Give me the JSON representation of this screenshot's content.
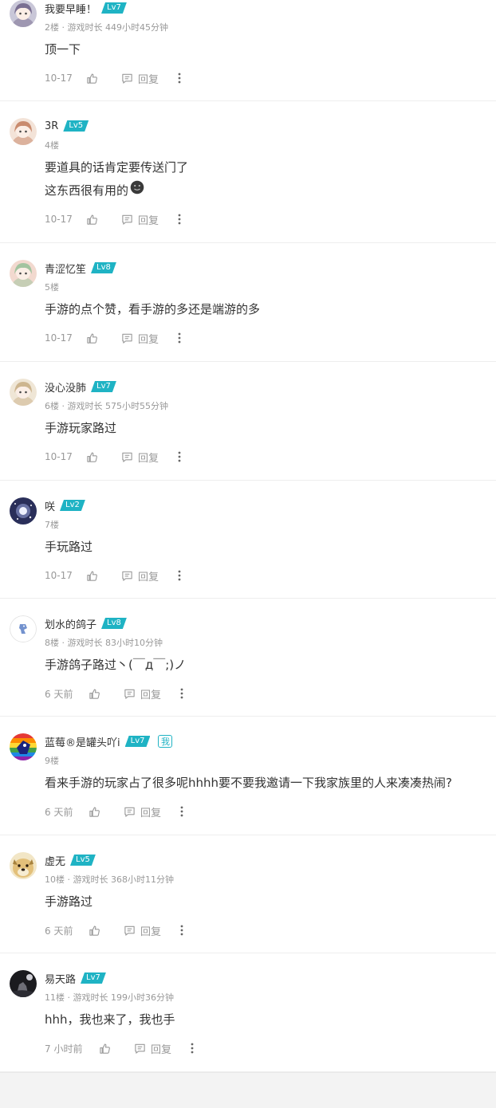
{
  "comments": [
    {
      "name": "我要早睡！",
      "level": "Lv7",
      "floor": "2楼",
      "playtime": "游戏时长 449小时45分钟",
      "lines": [
        "顶一下"
      ],
      "date": "10-17",
      "reply": "回复",
      "avatar": "avatar-anime-girl-pink",
      "colors": [
        "#c9c7d8",
        "#7a6f92"
      ]
    },
    {
      "name": "3R",
      "level": "Lv5",
      "floor": "4楼",
      "playtime": "",
      "lines": [
        "要道具的话肯定要传送门了",
        "这东西很有用的"
      ],
      "emoji": "grinning-face-emoji",
      "date": "10-17",
      "reply": "回复",
      "avatar": "avatar-anime-girl-white-hair",
      "colors": [
        "#f3e3d8",
        "#c98b6e"
      ]
    },
    {
      "name": "青涩忆笙",
      "level": "Lv8",
      "floor": "5楼",
      "playtime": "",
      "lines": [
        "手游的点个赞，看手游的多还是端游的多"
      ],
      "date": "10-17",
      "reply": "回复",
      "avatar": "avatar-anime-sleeping",
      "colors": [
        "#f2d9cf",
        "#a3c4a0"
      ]
    },
    {
      "name": "没心没肺",
      "level": "Lv7",
      "floor": "6楼",
      "playtime": "游戏时长 575小时55分钟",
      "lines": [
        "手游玩家路过"
      ],
      "date": "10-17",
      "reply": "回复",
      "avatar": "avatar-anime-girl-blonde",
      "colors": [
        "#efe6d6",
        "#cdb58f"
      ]
    },
    {
      "name": "咲",
      "level": "Lv2",
      "floor": "7楼",
      "playtime": "",
      "lines": [
        "手玩路过"
      ],
      "date": "10-17",
      "reply": "回复",
      "avatar": "avatar-night-galaxy",
      "colors": [
        "#2a2f5a",
        "#9aa7e0"
      ]
    },
    {
      "name": "划水的鸽子",
      "level": "Lv8",
      "floor": "8楼",
      "playtime": "游戏时长 83小时10分钟",
      "lines": [
        "手游鸽子路过丶(￣д￣;)ノ"
      ],
      "date": "6 天前",
      "reply": "回复",
      "avatar": "avatar-pigeon-logo",
      "colors": [
        "#ffffff",
        "#5b7fc6"
      ]
    },
    {
      "name": "蓝莓®是罐头吖i",
      "level": "Lv7",
      "badge": "我",
      "floor": "9楼",
      "playtime": "",
      "lines": [
        "看来手游的玩家占了很多呢hhhh要不要我邀请一下我家族里的人来凑凑热闹?"
      ],
      "date": "6 天前",
      "reply": "回复",
      "avatar": "avatar-rainbow-bird",
      "colors": [
        "#2a3aa8",
        "#3bb34a"
      ]
    },
    {
      "name": "虚无",
      "level": "Lv5",
      "floor": "10楼",
      "playtime": "游戏时长 368小时11分钟",
      "lines": [
        "手游路过"
      ],
      "date": "6 天前",
      "reply": "回复",
      "avatar": "avatar-doge",
      "colors": [
        "#e3c07a",
        "#a8833e"
      ]
    },
    {
      "name": "易天路",
      "level": "Lv7",
      "floor": "11楼",
      "playtime": "游戏时长 199小时36分钟",
      "lines": [
        "hhh，我也来了，我也手"
      ],
      "date": "7 小时前",
      "reply": "回复",
      "avatar": "avatar-silhouette-dark",
      "colors": [
        "#1b1b1f",
        "#6e6e76"
      ]
    }
  ],
  "colors": {
    "level_badge": "#1fb3c4",
    "divider": "#eeeeee",
    "meta_text": "#999999",
    "footer_band": "#f3f3f3"
  }
}
